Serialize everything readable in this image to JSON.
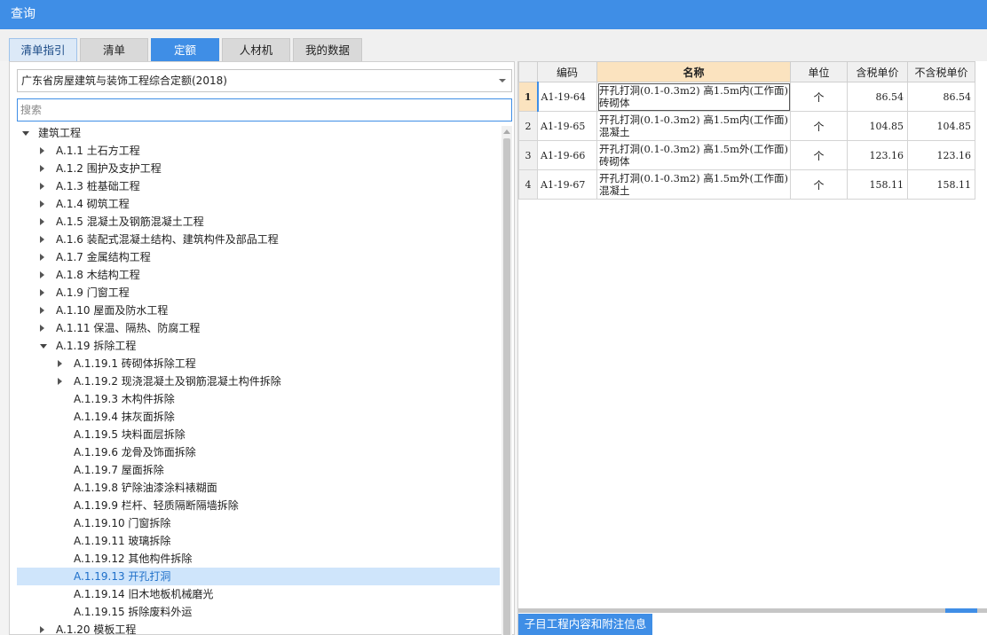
{
  "window": {
    "title": "查询"
  },
  "tabs": [
    {
      "label": "清单指引"
    },
    {
      "label": "清单"
    },
    {
      "label": "定额"
    },
    {
      "label": "人材机"
    },
    {
      "label": "我的数据"
    }
  ],
  "left": {
    "library": "广东省房屋建筑与装饰工程综合定额(2018)",
    "search_placeholder": "搜索",
    "tree": [
      {
        "label": "建筑工程",
        "level": 0,
        "state": "expanded"
      },
      {
        "label": "A.1.1 土石方工程",
        "level": 1,
        "state": "collapsed"
      },
      {
        "label": "A.1.2 围护及支护工程",
        "level": 1,
        "state": "collapsed"
      },
      {
        "label": "A.1.3 桩基础工程",
        "level": 1,
        "state": "collapsed"
      },
      {
        "label": "A.1.4 砌筑工程",
        "level": 1,
        "state": "collapsed"
      },
      {
        "label": "A.1.5 混凝土及钢筋混凝土工程",
        "level": 1,
        "state": "collapsed"
      },
      {
        "label": "A.1.6 装配式混凝土结构、建筑构件及部品工程",
        "level": 1,
        "state": "collapsed"
      },
      {
        "label": "A.1.7 金属结构工程",
        "level": 1,
        "state": "collapsed"
      },
      {
        "label": "A.1.8 木结构工程",
        "level": 1,
        "state": "collapsed"
      },
      {
        "label": "A.1.9 门窗工程",
        "level": 1,
        "state": "collapsed"
      },
      {
        "label": "A.1.10 屋面及防水工程",
        "level": 1,
        "state": "collapsed"
      },
      {
        "label": "A.1.11 保温、隔热、防腐工程",
        "level": 1,
        "state": "collapsed"
      },
      {
        "label": "A.1.19 拆除工程",
        "level": 1,
        "state": "expanded"
      },
      {
        "label": "A.1.19.1 砖砌体拆除工程",
        "level": 2,
        "state": "collapsed"
      },
      {
        "label": "A.1.19.2 现浇混凝土及钢筋混凝土构件拆除",
        "level": 2,
        "state": "collapsed"
      },
      {
        "label": "A.1.19.3 木构件拆除",
        "level": 2,
        "state": "leaf"
      },
      {
        "label": "A.1.19.4 抹灰面拆除",
        "level": 2,
        "state": "leaf"
      },
      {
        "label": "A.1.19.5 块料面层拆除",
        "level": 2,
        "state": "leaf"
      },
      {
        "label": "A.1.19.6 龙骨及饰面拆除",
        "level": 2,
        "state": "leaf"
      },
      {
        "label": "A.1.19.7 屋面拆除",
        "level": 2,
        "state": "leaf"
      },
      {
        "label": "A.1.19.8 铲除油漆涂料裱糊面",
        "level": 2,
        "state": "leaf"
      },
      {
        "label": "A.1.19.9 栏杆、轻质隔断隔墙拆除",
        "level": 2,
        "state": "leaf"
      },
      {
        "label": "A.1.19.10 门窗拆除",
        "level": 2,
        "state": "leaf"
      },
      {
        "label": "A.1.19.11 玻璃拆除",
        "level": 2,
        "state": "leaf"
      },
      {
        "label": "A.1.19.12 其他构件拆除",
        "level": 2,
        "state": "leaf"
      },
      {
        "label": "A.1.19.13 开孔打洞",
        "level": 2,
        "state": "leaf",
        "selected": true
      },
      {
        "label": "A.1.19.14 旧木地板机械磨光",
        "level": 2,
        "state": "leaf"
      },
      {
        "label": "A.1.19.15 拆除废料外运",
        "level": 2,
        "state": "leaf"
      },
      {
        "label": "A.1.20 模板工程",
        "level": 1,
        "state": "collapsed"
      }
    ]
  },
  "grid": {
    "headers": {
      "code": "编码",
      "name": "名称",
      "unit": "单位",
      "price_tax": "含税单价",
      "price_notax": "不含税单价"
    },
    "rows": [
      {
        "num": "1",
        "code": "A1-19-64",
        "name": "开孔打洞(0.1-0.3m2) 高1.5m内(工作面) 砖砌体",
        "unit": "个",
        "price_tax": "86.54",
        "price_notax": "86.54"
      },
      {
        "num": "2",
        "code": "A1-19-65",
        "name": "开孔打洞(0.1-0.3m2) 高1.5m内(工作面) 混凝土",
        "unit": "个",
        "price_tax": "104.85",
        "price_notax": "104.85"
      },
      {
        "num": "3",
        "code": "A1-19-66",
        "name": "开孔打洞(0.1-0.3m2) 高1.5m外(工作面) 砖砌体",
        "unit": "个",
        "price_tax": "123.16",
        "price_notax": "123.16"
      },
      {
        "num": "4",
        "code": "A1-19-67",
        "name": "开孔打洞(0.1-0.3m2) 高1.5m外(工作面) 混凝土",
        "unit": "个",
        "price_tax": "158.11",
        "price_notax": "158.11"
      }
    ]
  },
  "bottom_tab": {
    "label": "子目工程内容和附注信息"
  },
  "colors": {
    "accent": "#3f8ee6",
    "header_highlight": "#fbe3bf",
    "selection": "#cfe5fb"
  }
}
